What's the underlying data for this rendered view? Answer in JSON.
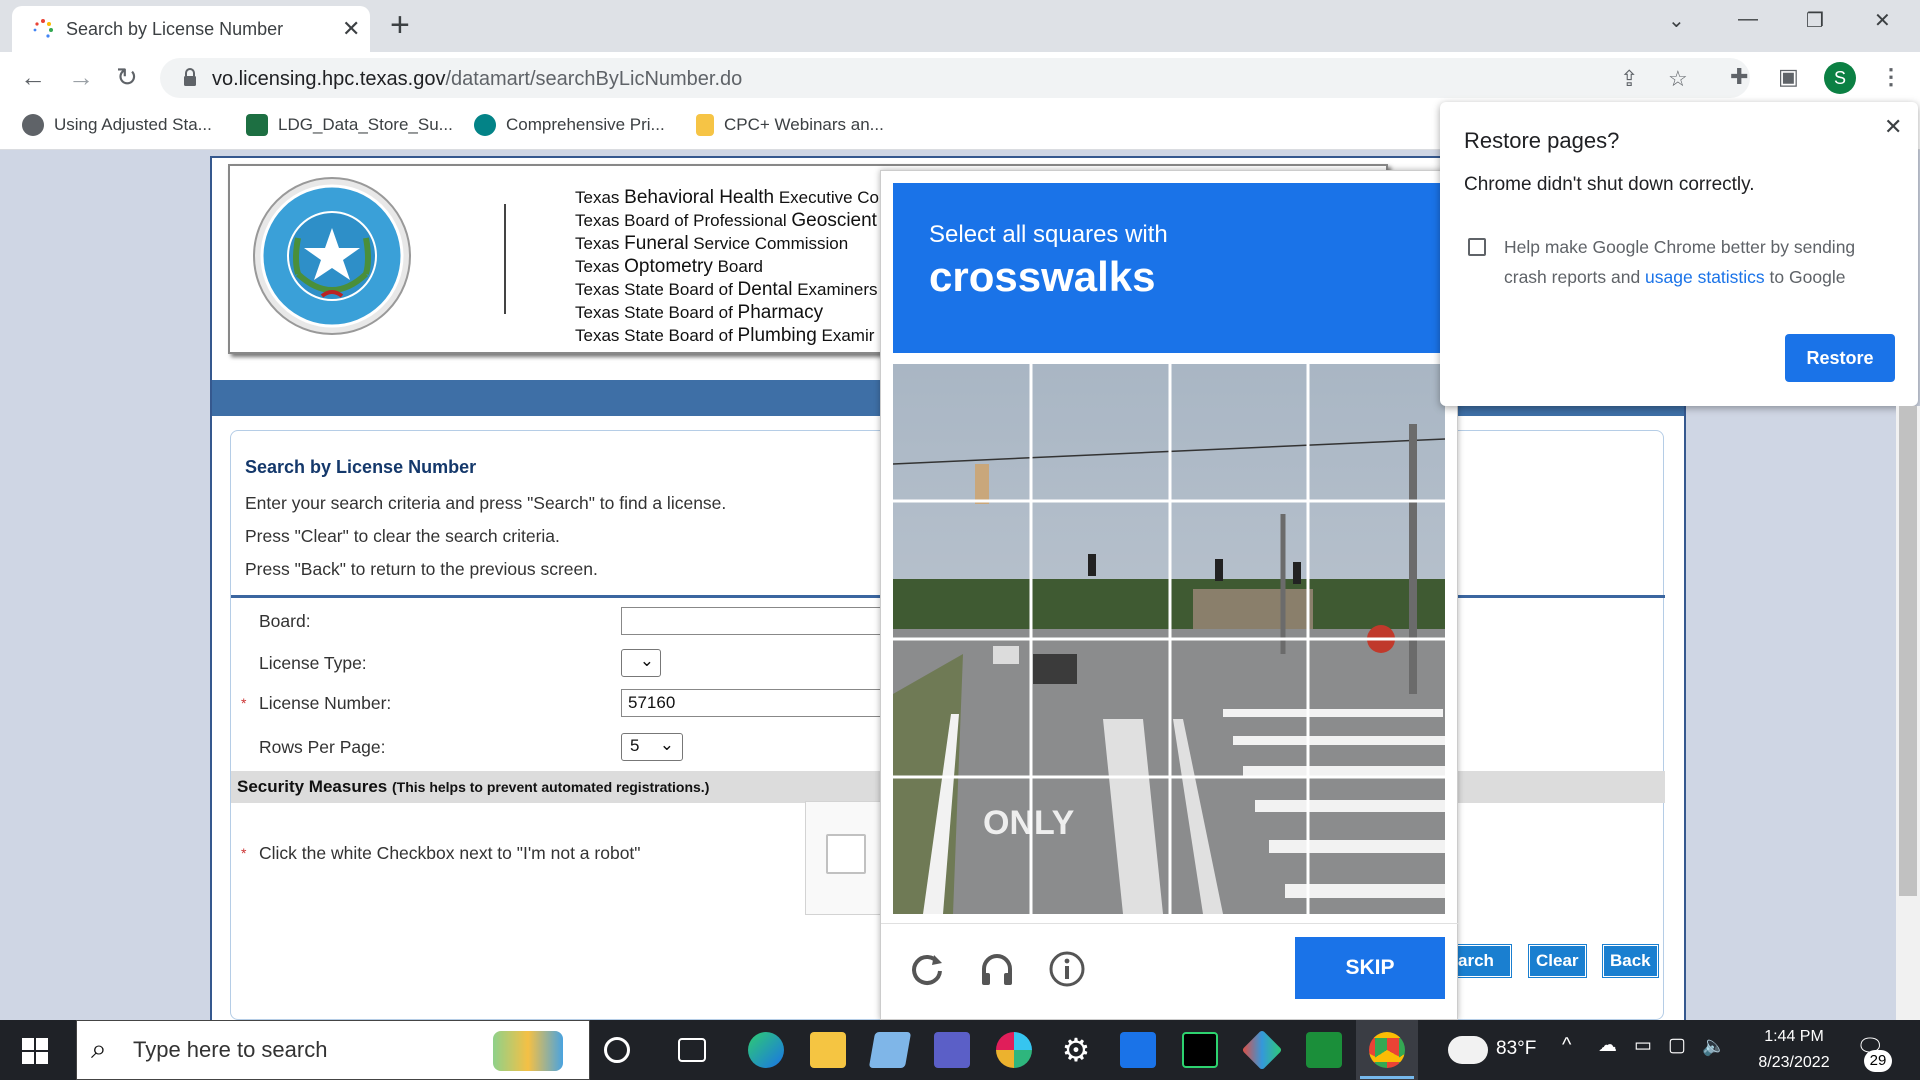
{
  "browser": {
    "tab_title": "Search by License Number",
    "tab_close": "✕",
    "new_tab": "+",
    "url_host": "vo.licensing.hpc.texas.gov",
    "url_path": "/datamart/searchByLicNumber.do",
    "avatar_letter": "S",
    "bookmarks": [
      {
        "label": "Using Adjusted Sta...",
        "icon": "globe-icon",
        "color": "#555"
      },
      {
        "label": "LDG_Data_Store_Su...",
        "icon": "excel-icon",
        "color": "#1d6f42"
      },
      {
        "label": "Comprehensive Pri...",
        "icon": "sharepoint-icon",
        "color": "#038387"
      },
      {
        "label": "CPC+ Webinars an...",
        "icon": "folder-icon",
        "color": "#f6c445"
      }
    ]
  },
  "banner": {
    "seal_text": "THE STATE OF TEXAS",
    "boards": [
      {
        "pre": "Texas ",
        "main": "Behavioral Health",
        "post": " Executive Co"
      },
      {
        "pre": "Texas Board of Professional ",
        "main": "Geoscient",
        "post": ""
      },
      {
        "pre": "Texas ",
        "main": "Funeral",
        "post": " Service Commission"
      },
      {
        "pre": "Texas ",
        "main": "Optometry",
        "post": " Board"
      },
      {
        "pre": "Texas State Board of ",
        "main": "Dental",
        "post": " Examiners"
      },
      {
        "pre": "Texas State Board of ",
        "main": "Pharmacy",
        "post": ""
      },
      {
        "pre": "Texas State Board of ",
        "main": "Plumbing",
        "post": " Examir"
      }
    ]
  },
  "form": {
    "section_title": "Search by License Number",
    "instructions": [
      "Enter your search criteria and press \"Search\" to find a license.",
      "Press \"Clear\" to clear the search criteria.",
      "Press \"Back\" to return to the previous screen."
    ],
    "board_label": "Board:",
    "board_value": "",
    "license_type_label": "License Type:",
    "license_type_value": "",
    "license_number_label": "License Number:",
    "license_number_value": "57160",
    "rows_label": "Rows Per Page:",
    "rows_value": "5",
    "required_mark": "*",
    "security_title": "Security Measures",
    "security_note": "(This helps to prevent automated registrations.)",
    "robot_instruction": "Click the white Checkbox next to \"I'm not a robot\"",
    "search_btn": "arch",
    "clear_btn": "Clear",
    "back_btn": "Back"
  },
  "captcha": {
    "line1": "Select all squares with",
    "line2": "crosswalks",
    "skip": "SKIP",
    "road_text": "ONLY"
  },
  "restore": {
    "title": "Restore pages?",
    "message": "Chrome didn't shut down correctly.",
    "help_pre": "Help make Google Chrome better by sending crash reports and ",
    "help_link": "usage statistics",
    "help_post": " to Google",
    "button": "Restore"
  },
  "taskbar": {
    "search_placeholder": "Type here to search",
    "temperature": "83°F",
    "time": "1:44 PM",
    "date": "8/23/2022",
    "notifications": "29"
  }
}
